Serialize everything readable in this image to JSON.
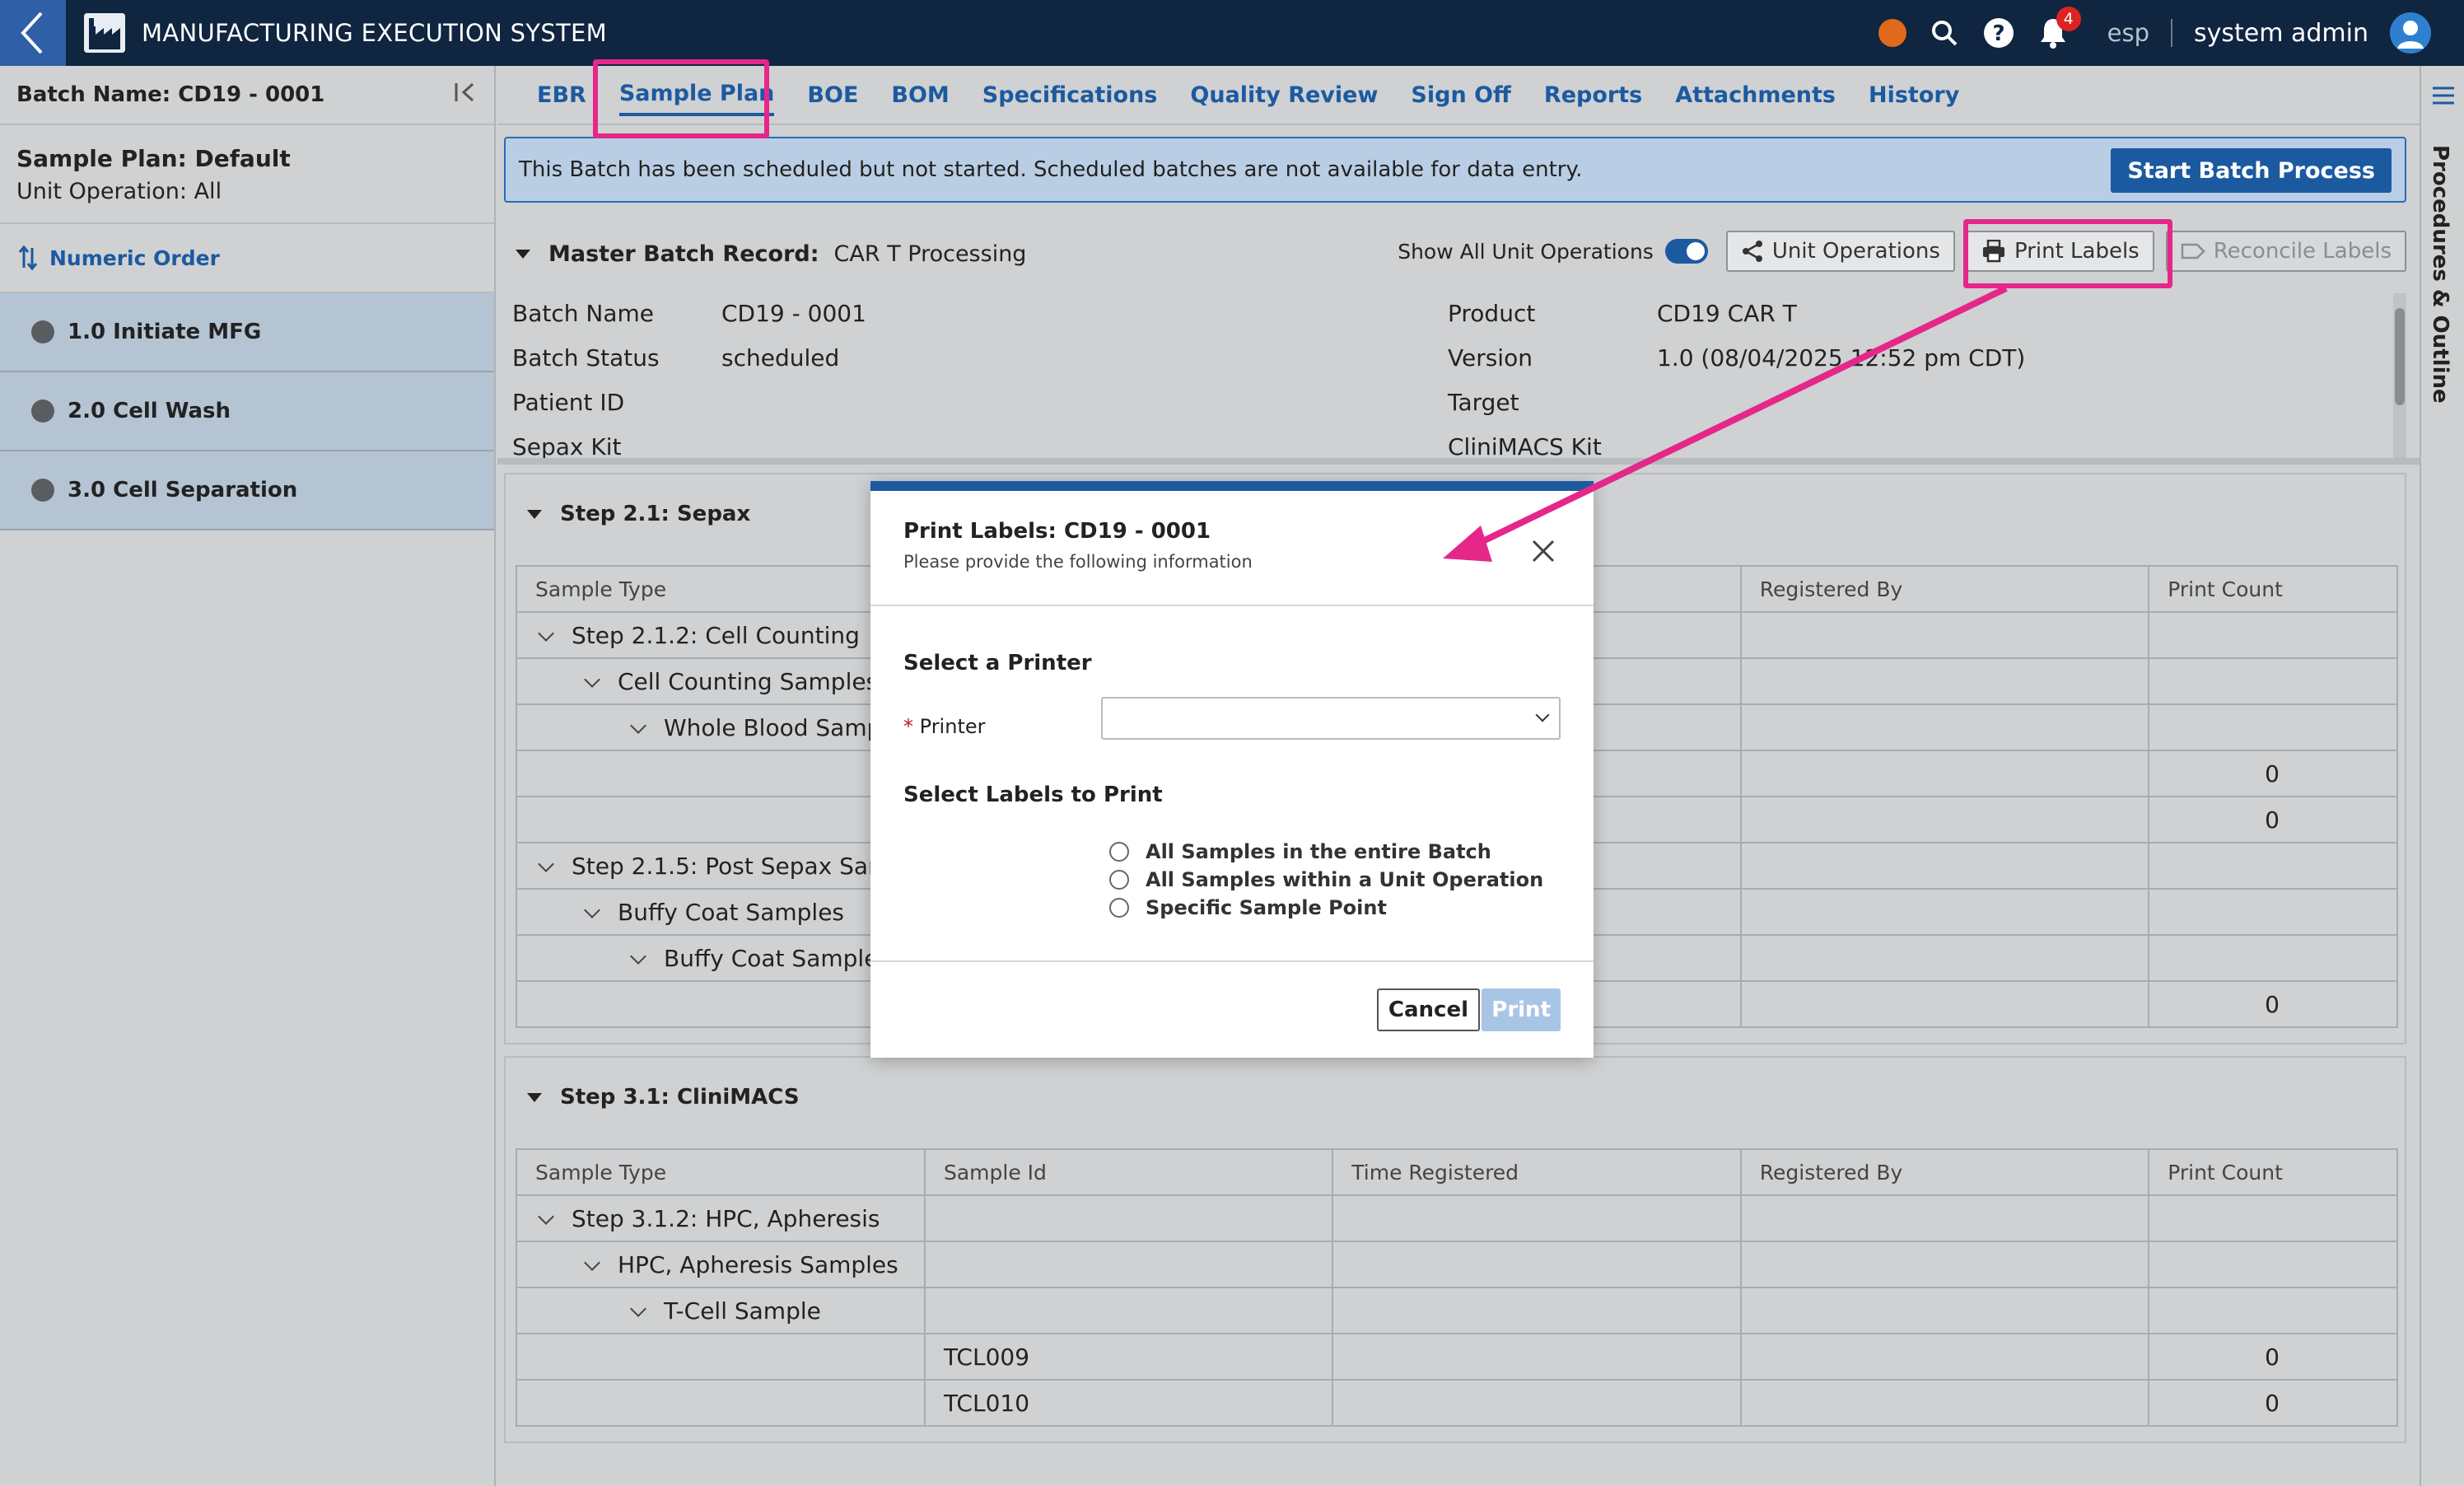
{
  "app": {
    "title": "MANUFACTURING EXECUTION SYSTEM",
    "env": "esp",
    "user": "system admin",
    "notification_count": "4",
    "status_color": "#e06a1b",
    "accent": "#1c5aa0",
    "highlight": "#e5278a"
  },
  "sidebar": {
    "batch_name": "Batch Name: CD19 - 0001",
    "plan_title": "Sample Plan: Default",
    "plan_sub": "Unit Operation: All",
    "order_label": "Numeric Order",
    "items": [
      {
        "label": "1.0 Initiate MFG"
      },
      {
        "label": "2.0 Cell Wash"
      },
      {
        "label": "3.0 Cell Separation"
      }
    ]
  },
  "tabs": [
    {
      "label": "EBR"
    },
    {
      "label": "Sample Plan",
      "active": true
    },
    {
      "label": "BOE"
    },
    {
      "label": "BOM"
    },
    {
      "label": "Specifications"
    },
    {
      "label": "Quality Review"
    },
    {
      "label": "Sign Off"
    },
    {
      "label": "Reports"
    },
    {
      "label": "Attachments"
    },
    {
      "label": "History"
    }
  ],
  "right_panel": {
    "label": "Procedures & Outline"
  },
  "notice": {
    "text": "This Batch has been scheduled but not started. Scheduled batches are not available for data entry.",
    "button": "Start Batch Process"
  },
  "mbr": {
    "label": "Master Batch Record:",
    "value": "CAR T Processing",
    "show_all_label": "Show All Unit Operations",
    "unit_ops_button": "Unit Operations",
    "print_labels_button": "Print Labels",
    "reconcile_button": "Reconcile Labels",
    "fields_left": [
      {
        "key": "Batch Name",
        "value": "CD19 - 0001"
      },
      {
        "key": "Batch Status",
        "value": "scheduled"
      },
      {
        "key": "Patient ID",
        "value": ""
      },
      {
        "key": "Sepax Kit",
        "value": ""
      }
    ],
    "fields_right": [
      {
        "key": "Product",
        "value": "CD19 CAR T"
      },
      {
        "key": "Version",
        "value": "1.0 (08/04/2025 12:52 pm CDT)"
      },
      {
        "key": "Target",
        "value": ""
      },
      {
        "key": "CliniMACS Kit",
        "value": ""
      }
    ]
  },
  "table_headers": [
    "Sample Type",
    "Sample Id",
    "Time Registered",
    "Registered By",
    "Print Count"
  ],
  "step21": {
    "title": "Step 2.1: Sepax",
    "rows": [
      {
        "type": "Step 2.1.2: Cell Counting",
        "level": 1,
        "count": ""
      },
      {
        "type": "Cell Counting Samples",
        "level": 2,
        "count": ""
      },
      {
        "type": "Whole Blood Samp",
        "level": 3,
        "count": ""
      },
      {
        "type": "",
        "level": 0,
        "count": "0"
      },
      {
        "type": "",
        "level": 0,
        "count": "0"
      },
      {
        "type": "Step 2.1.5: Post Sepax Sam",
        "level": 1,
        "count": ""
      },
      {
        "type": "Buffy Coat Samples",
        "level": 2,
        "count": ""
      },
      {
        "type": "Buffy Coat Sample",
        "level": 3,
        "count": ""
      },
      {
        "type": "",
        "level": 0,
        "count": "0"
      }
    ]
  },
  "step31": {
    "title": "Step 3.1: CliniMACS",
    "rows": [
      {
        "type": "Step 3.1.2: HPC, Apheresis",
        "level": 1,
        "id": "",
        "count": ""
      },
      {
        "type": "HPC, Apheresis Samples",
        "level": 2,
        "id": "",
        "count": ""
      },
      {
        "type": "T-Cell Sample",
        "level": 3,
        "id": "",
        "count": ""
      },
      {
        "type": "",
        "level": 0,
        "id": "TCL009",
        "count": "0"
      },
      {
        "type": "",
        "level": 0,
        "id": "TCL010",
        "count": "0"
      }
    ]
  },
  "modal": {
    "title": "Print Labels: CD19 - 0001",
    "subtitle": "Please provide the following information",
    "printer_section": "Select a Printer",
    "printer_label": "Printer",
    "required_mark": "*",
    "labels_section": "Select Labels to Print",
    "options": [
      "All Samples in the entire Batch",
      "All Samples within a Unit Operation",
      "Specific Sample Point"
    ],
    "cancel": "Cancel",
    "print": "Print"
  }
}
